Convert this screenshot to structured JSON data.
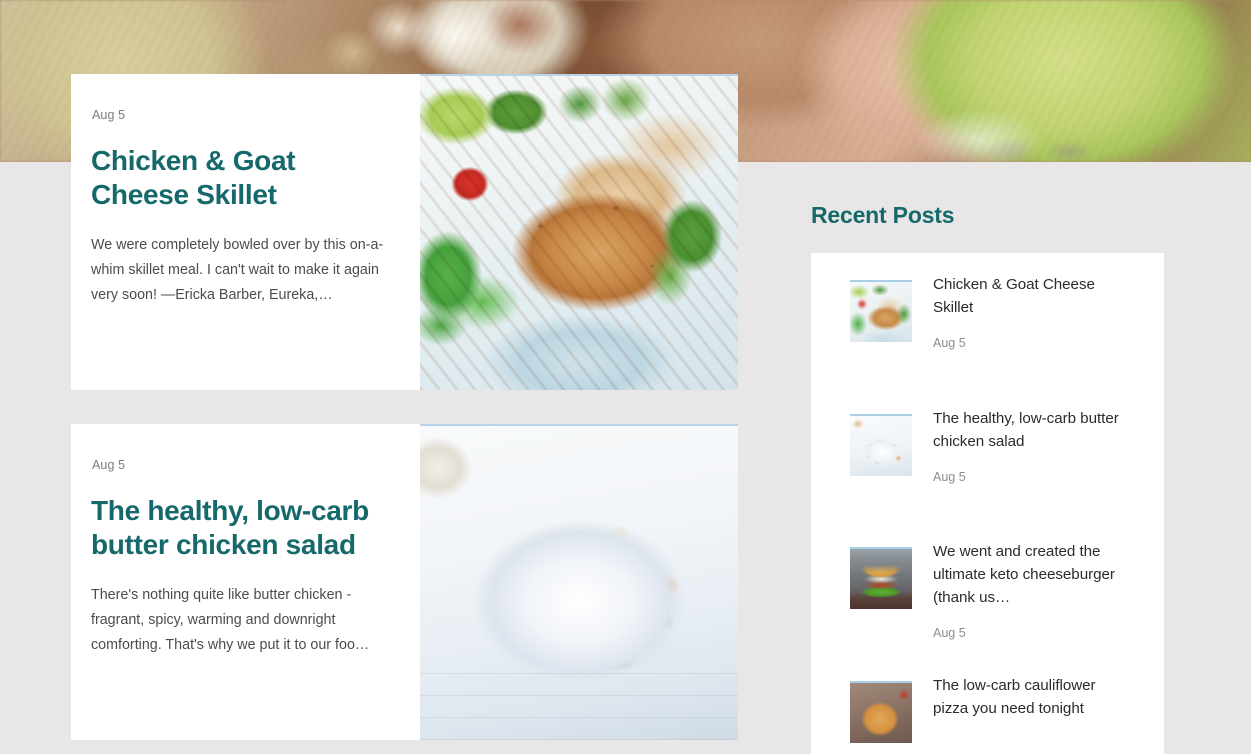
{
  "hero": {
    "alt": "blurred food photo banner with nuts, eggs and melon"
  },
  "main": {
    "posts": [
      {
        "date": "Aug 5",
        "title": "Chicken & Goat Cheese Skillet",
        "excerpt": "We were completely bowled over by this on-a-whim skillet meal. I can't wait to make it again very soon! —Ericka Barber, Eureka,…",
        "image_alt": "grilled chicken breast with green beans and tomato"
      },
      {
        "date": "Aug 5",
        "title": "The healthy, low-carb butter chicken salad",
        "excerpt": "There's nothing quite like butter chicken - fragrant, spicy, warming and downright comforting. That's why we put it to our foo…",
        "image_alt": "roasted vegetable and halloumi salad in a white bowl"
      }
    ]
  },
  "sidebar": {
    "title": "Recent Posts",
    "items": [
      {
        "title": "Chicken & Goat Cheese Skillet",
        "date": "Aug 5",
        "thumb_alt": "chicken skillet thumbnail"
      },
      {
        "title": "The healthy, low-carb butter chicken salad",
        "date": "Aug 5",
        "thumb_alt": "butter chicken salad thumbnail"
      },
      {
        "title": "We went and created the ultimate keto cheeseburger (thank us…",
        "date": "Aug 5",
        "thumb_alt": "keto cheeseburger thumbnail"
      },
      {
        "title": "The low-carb cauliflower pizza you need tonight",
        "date": "",
        "thumb_alt": "cauliflower pizza thumbnail"
      }
    ]
  },
  "colors": {
    "accent_teal": "#15696b",
    "page_background": "#e8e6e6",
    "card_background": "#ffffff",
    "body_text": "#4c4c4c",
    "date_text": "#8d8d8d",
    "image_top_rule": "#b9d4ea"
  }
}
